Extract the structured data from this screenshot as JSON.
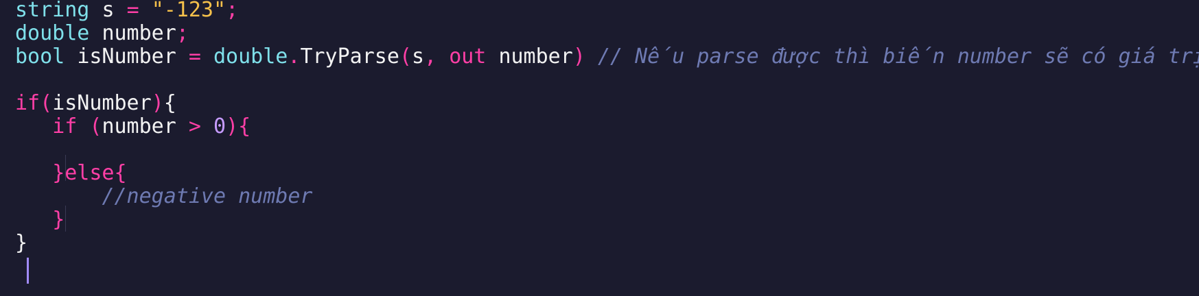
{
  "code": {
    "lines": [
      {
        "tokens": [
          {
            "text": "string",
            "kind": "type"
          },
          {
            "text": " ",
            "kind": "space"
          },
          {
            "text": "s",
            "kind": "var"
          },
          {
            "text": " ",
            "kind": "space"
          },
          {
            "text": "=",
            "kind": "op"
          },
          {
            "text": " ",
            "kind": "space"
          },
          {
            "text": "\"-123\"",
            "kind": "str"
          },
          {
            "text": ";",
            "kind": "punc"
          }
        ]
      },
      {
        "tokens": [
          {
            "text": "double",
            "kind": "type"
          },
          {
            "text": " ",
            "kind": "space"
          },
          {
            "text": "number",
            "kind": "var"
          },
          {
            "text": ";",
            "kind": "punc"
          }
        ]
      },
      {
        "tokens": [
          {
            "text": "bool",
            "kind": "type"
          },
          {
            "text": " ",
            "kind": "space"
          },
          {
            "text": "isNumber",
            "kind": "var"
          },
          {
            "text": " ",
            "kind": "space"
          },
          {
            "text": "=",
            "kind": "op"
          },
          {
            "text": " ",
            "kind": "space"
          },
          {
            "text": "double",
            "kind": "type"
          },
          {
            "text": ".",
            "kind": "punc"
          },
          {
            "text": "TryParse",
            "kind": "method"
          },
          {
            "text": "(",
            "kind": "punc"
          },
          {
            "text": "s",
            "kind": "var"
          },
          {
            "text": ",",
            "kind": "punc"
          },
          {
            "text": " ",
            "kind": "space"
          },
          {
            "text": "out",
            "kind": "kw"
          },
          {
            "text": " ",
            "kind": "space"
          },
          {
            "text": "number",
            "kind": "var"
          },
          {
            "text": ")",
            "kind": "punc"
          },
          {
            "text": " ",
            "kind": "space"
          },
          {
            "text": "// Nếu parse được thì biến number sẽ có giá trị",
            "kind": "comment"
          }
        ]
      },
      {
        "tokens": []
      },
      {
        "tokens": [
          {
            "text": "if",
            "kind": "kw"
          },
          {
            "text": "(",
            "kind": "punc"
          },
          {
            "text": "isNumber",
            "kind": "var"
          },
          {
            "text": ")",
            "kind": "punc"
          },
          {
            "text": "{",
            "kind": "var"
          }
        ]
      },
      {
        "tokens": [
          {
            "text": "   ",
            "kind": "space"
          },
          {
            "text": "if",
            "kind": "kw"
          },
          {
            "text": " ",
            "kind": "space"
          },
          {
            "text": "(",
            "kind": "punc"
          },
          {
            "text": "number",
            "kind": "var"
          },
          {
            "text": " ",
            "kind": "space"
          },
          {
            "text": ">",
            "kind": "op"
          },
          {
            "text": " ",
            "kind": "space"
          },
          {
            "text": "0",
            "kind": "num"
          },
          {
            "text": ")",
            "kind": "punc"
          },
          {
            "text": "{",
            "kind": "punc"
          }
        ]
      },
      {
        "tokens": []
      },
      {
        "tokens": [
          {
            "text": "   ",
            "kind": "space"
          },
          {
            "text": "}",
            "kind": "punc"
          },
          {
            "text": "else",
            "kind": "kw"
          },
          {
            "text": "{",
            "kind": "punc"
          }
        ]
      },
      {
        "tokens": [
          {
            "text": "       ",
            "kind": "space"
          },
          {
            "text": "//negative number",
            "kind": "comment"
          }
        ]
      },
      {
        "tokens": [
          {
            "text": "   ",
            "kind": "space"
          },
          {
            "text": "}",
            "kind": "punc"
          }
        ]
      },
      {
        "tokens": [
          {
            "text": "}",
            "kind": "var"
          }
        ]
      }
    ]
  },
  "colors": {
    "background": "#1b1b2e",
    "type": "#7fe0ea",
    "keyword": "#ff3fa6",
    "string": "#f6c14b",
    "number": "#c69bff",
    "comment": "#6e7ab2",
    "cursor": "#a28bff"
  }
}
